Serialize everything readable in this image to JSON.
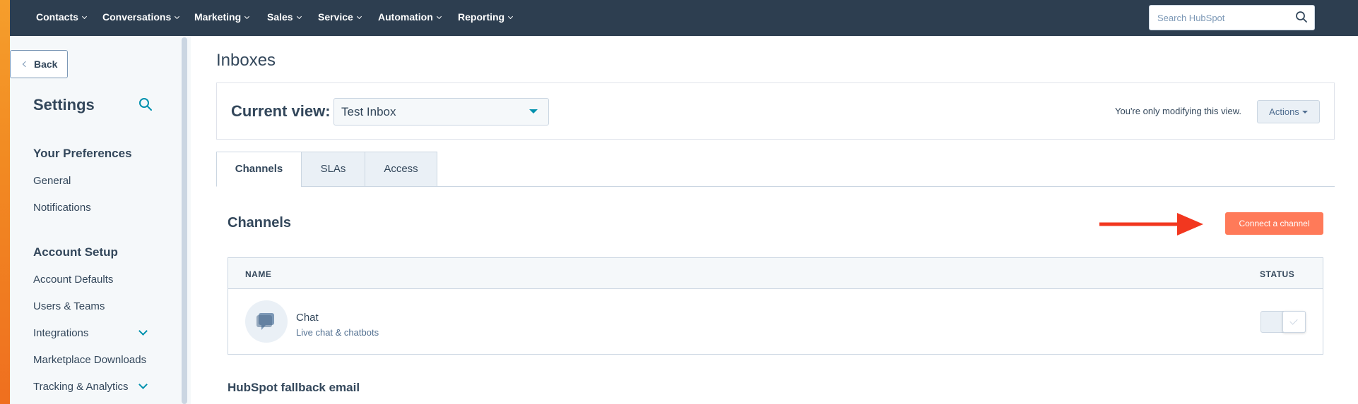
{
  "topnav": {
    "items": [
      "Contacts",
      "Conversations",
      "Marketing",
      "Sales",
      "Service",
      "Automation",
      "Reporting"
    ],
    "search_placeholder": "Search HubSpot"
  },
  "sidebar": {
    "back_label": "Back",
    "title": "Settings",
    "sections": [
      {
        "heading": "Your Preferences",
        "items": [
          "General",
          "Notifications"
        ]
      },
      {
        "heading": "Account Setup",
        "items": [
          "Account Defaults",
          "Users & Teams",
          "Integrations",
          "Marketplace Downloads",
          "Tracking & Analytics"
        ]
      }
    ]
  },
  "main": {
    "page_title": "Inboxes",
    "current_view_label": "Current view:",
    "current_view_value": "Test Inbox",
    "modify_note": "You're only modifying this view.",
    "actions_label": "Actions",
    "tabs": [
      "Channels",
      "SLAs",
      "Access"
    ],
    "channels_title": "Channels",
    "connect_label": "Connect a channel",
    "table": {
      "columns": [
        "NAME",
        "STATUS"
      ],
      "rows": [
        {
          "name": "Chat",
          "subtitle": "Live chat & chatbots"
        }
      ]
    },
    "fallback_title": "HubSpot fallback email"
  },
  "colors": {
    "nav_bg": "#2d3e50",
    "accent_teal": "#0091ae",
    "cta_orange": "#ff7a59",
    "annotation_arrow": "#f2371f"
  },
  "icons": [
    "search-icon",
    "chevron-down-icon",
    "chevron-left-icon",
    "chat-icon",
    "check-icon",
    "arrow-annotation"
  ]
}
